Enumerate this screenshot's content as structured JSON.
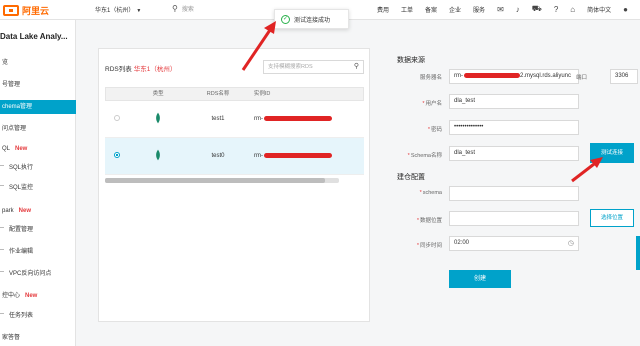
{
  "header": {
    "logo_text": "阿里云",
    "region": "华东1（杭州）",
    "search_placeholder": "搜索",
    "nav": [
      "费用",
      "工单",
      "备案",
      "企业",
      "服务"
    ],
    "lang": "简体中文"
  },
  "toast": {
    "message": "测试连接成功"
  },
  "sidebar": {
    "title": "Data Lake Analy...",
    "items": [
      {
        "label": "览",
        "active": false,
        "badge": ""
      },
      {
        "label": "号管理",
        "active": false,
        "badge": ""
      },
      {
        "label": "chema管理",
        "active": true,
        "badge": ""
      },
      {
        "label": "问点管理",
        "active": false,
        "badge": ""
      },
      {
        "label": "QL",
        "active": false,
        "badge": "New"
      },
      {
        "label": "SQL执行",
        "active": false,
        "badge": ""
      },
      {
        "label": "SQL监控",
        "active": false,
        "badge": ""
      },
      {
        "label": "park",
        "active": false,
        "badge": "New"
      },
      {
        "label": "配置管理",
        "active": false,
        "badge": ""
      },
      {
        "label": "作业编辑",
        "active": false,
        "badge": ""
      },
      {
        "label": "VPC反向访问点",
        "active": false,
        "badge": ""
      },
      {
        "label": "控中心",
        "active": false,
        "badge": "New"
      },
      {
        "label": "任务列表",
        "active": false,
        "badge": ""
      },
      {
        "label": "家答督",
        "active": false,
        "badge": ""
      }
    ]
  },
  "rds_panel": {
    "title": "RDS列表",
    "region": "华东1（杭州）",
    "search_placeholder": "支持模糊搜索RDS",
    "columns": [
      "类型",
      "RDS名称",
      "实例ID"
    ],
    "rows": [
      {
        "name": "test1",
        "instance_prefix": "rm-",
        "selected": false
      },
      {
        "name": "test0",
        "instance_prefix": "rm-",
        "selected": true
      }
    ]
  },
  "datasource": {
    "section_title": "数据来源",
    "server_label": "服务器名",
    "server_value_prefix": "rm-",
    "server_value_suffix": "2.mysql.rds.aliyunc",
    "port_label": "端口",
    "port_value": "3306",
    "user_label": "用户名",
    "user_value": "dla_test",
    "password_label": "密码",
    "password_value": "••••••••••••••",
    "schema_label": "Schema名称",
    "schema_value": "dla_test",
    "test_button": "测试连接"
  },
  "warehouse": {
    "section_title": "建仓配置",
    "schema_label": "schema",
    "schema_value": "",
    "location_label": "数据位置",
    "location_value": "",
    "location_button": "选择位置",
    "sync_label": "同步时间",
    "sync_value": "02:00",
    "create_button": "创建"
  },
  "colors": {
    "accent": "#00a2ca",
    "brand": "#ff6a00",
    "annotation": "#e02424"
  }
}
